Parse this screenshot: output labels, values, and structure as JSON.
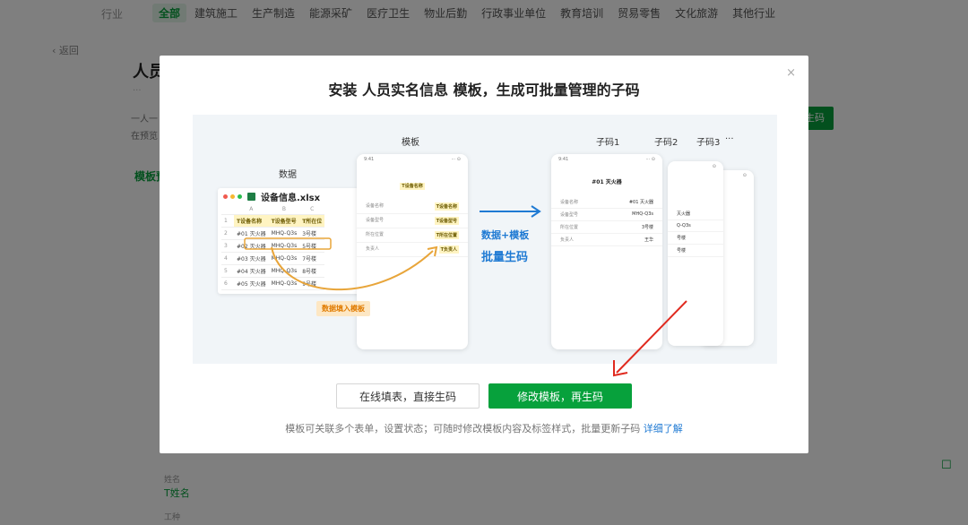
{
  "top_nav": {
    "label": "行业",
    "items": [
      "全部",
      "建筑施工",
      "生产制造",
      "能源采矿",
      "医疗卫生",
      "物业后勤",
      "行政事业单位",
      "教育培训",
      "贸易零售",
      "文化旅游",
      "其他行业"
    ],
    "active_index": 0
  },
  "background": {
    "back": "返回",
    "title": "人员",
    "text1": "一人一",
    "text2": "在预览",
    "tab": "模板预",
    "green_button": "生码",
    "field_label1": "姓名",
    "field_value1": "T姓名",
    "field_label2": "工种"
  },
  "modal": {
    "title": "安装 人员实名信息 模板，生成可批量管理的子码",
    "close": "×",
    "illustration": {
      "data_label": "数据",
      "template_label": "模板",
      "subcode_labels": [
        "子码1",
        "子码2",
        "子码3",
        "···"
      ],
      "excel_file": "设备信息.xlsx",
      "excel_cols": [
        "A",
        "B",
        "C"
      ],
      "excel_headers": [
        "T设备名称",
        "T设备型号",
        "T所在位"
      ],
      "excel_rows": [
        [
          "1",
          "",
          "",
          ""
        ],
        [
          "2",
          "#01 灭火器",
          "MHQ-Q3s",
          "3号楼"
        ],
        [
          "3",
          "#02 灭火器",
          "MHQ-Q3s",
          "5号楼"
        ],
        [
          "4",
          "#03 灭火器",
          "MHQ-Q3s",
          "7号楼"
        ],
        [
          "5",
          "#04 灭火器",
          "MHQ-Q3s",
          "8号楼"
        ],
        [
          "6",
          "#05 灭火器",
          "MHQ-Q3s",
          "9号楼"
        ]
      ],
      "fill_badge": "数据填入模板",
      "arrow_text1": "数据+模板",
      "arrow_text2": "批量生码",
      "template_phone": {
        "time": "9:41",
        "title_tag": "T设备名称",
        "rows": [
          [
            "设备名称",
            "T设备名称"
          ],
          [
            "设备型号",
            "T设备型号"
          ],
          [
            "所在位置",
            "T所在位置"
          ],
          [
            "负责人",
            "T负责人"
          ]
        ]
      },
      "code_phone": {
        "time": "9:41",
        "title": "#01 灭火器",
        "rows": [
          [
            "设备名称",
            "#01 灭火器"
          ],
          [
            "设备型号",
            "MHQ-Q3s"
          ],
          [
            "所在位置",
            "3号楼"
          ],
          [
            "负责人",
            "王华"
          ]
        ]
      },
      "back_phone_rows": [
        "灭火器",
        "Q-Q3s",
        "号楼",
        "号楼"
      ]
    },
    "buttons": {
      "secondary": "在线填表，直接生码",
      "primary": "修改模板，再生码"
    },
    "description": "模板可关联多个表单，设置状态；可随时修改模板内容及标签样式，批量更新子码",
    "description_link": "详细了解"
  },
  "colors": {
    "brand_green": "#07a13c",
    "link_blue": "#1f7ad3",
    "arrow_red": "#e02a1f",
    "highlight_orange": "#e8a53a"
  }
}
